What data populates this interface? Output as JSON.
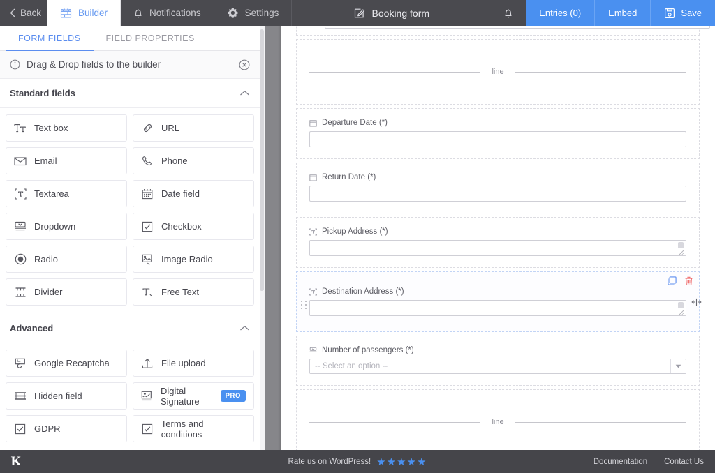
{
  "topbar": {
    "back_label": "Back",
    "tabs": [
      {
        "label": "Builder",
        "icon": "builder-icon",
        "active": true
      },
      {
        "label": "Notifications",
        "icon": "bell-icon",
        "active": false
      },
      {
        "label": "Settings",
        "icon": "gear-icon",
        "active": false
      }
    ],
    "form_title": "Booking form",
    "form_title_icon": "edit-icon",
    "bell_icon": "bell-icon",
    "actions": [
      {
        "label": "Entries (0)",
        "icon": null
      },
      {
        "label": "Embed",
        "icon": null
      },
      {
        "label": "Save",
        "icon": "save-disk-icon"
      }
    ],
    "accent_color": "#4a90f0",
    "bar_color": "#4a4a4f"
  },
  "sidebar": {
    "tabs": [
      {
        "label": "FORM FIELDS",
        "active": true
      },
      {
        "label": "FIELD PROPERTIES",
        "active": false
      }
    ],
    "hint": {
      "text": "Drag & Drop fields to the builder",
      "info_icon": "info-circle-icon",
      "close_icon": "close-circle-icon"
    },
    "sections": [
      {
        "title": "Standard fields",
        "collapse_icon": "chevron-up-icon",
        "fields": [
          {
            "label": "Text box",
            "icon": "text-box-icon"
          },
          {
            "label": "URL",
            "icon": "link-icon"
          },
          {
            "label": "Email",
            "icon": "envelope-icon"
          },
          {
            "label": "Phone",
            "icon": "phone-icon"
          },
          {
            "label": "Textarea",
            "icon": "textarea-icon"
          },
          {
            "label": "Date field",
            "icon": "calendar-icon"
          },
          {
            "label": "Dropdown",
            "icon": "dropdown-icon"
          },
          {
            "label": "Checkbox",
            "icon": "checkbox-icon"
          },
          {
            "label": "Radio",
            "icon": "radio-icon"
          },
          {
            "label": "Image Radio",
            "icon": "image-radio-icon"
          },
          {
            "label": "Divider",
            "icon": "divider-icon"
          },
          {
            "label": "Free Text",
            "icon": "free-text-icon"
          }
        ]
      },
      {
        "title": "Advanced",
        "collapse_icon": "chevron-up-icon",
        "fields": [
          {
            "label": "Google Recaptcha",
            "icon": "recaptcha-icon"
          },
          {
            "label": "File upload",
            "icon": "upload-icon"
          },
          {
            "label": "Hidden field",
            "icon": "hidden-field-icon"
          },
          {
            "label": "Digital Signature",
            "icon": "signature-icon",
            "badge": "PRO"
          },
          {
            "label": "GDPR",
            "icon": "checkbox-icon"
          },
          {
            "label": "Terms and conditions",
            "icon": "checkbox-icon"
          }
        ]
      }
    ]
  },
  "canvas": {
    "fields": [
      {
        "type": "partial-input",
        "label": ""
      },
      {
        "type": "divider",
        "label": "line"
      },
      {
        "type": "text",
        "label": "Departure Date (*)",
        "icon": "calendar-icon"
      },
      {
        "type": "text",
        "label": "Return Date (*)",
        "icon": "calendar-icon"
      },
      {
        "type": "textarea",
        "label": "Pickup Address (*)",
        "icon": "textarea-icon"
      },
      {
        "type": "textarea",
        "label": "Destination Address (*)",
        "icon": "textarea-icon",
        "selected": true,
        "tools": {
          "duplicate_icon": "duplicate-icon",
          "delete_icon": "trash-icon",
          "drag_icon": "drag-handle-icon",
          "resize_icon": "resize-width-icon"
        }
      },
      {
        "type": "select",
        "label": "Number of passengers (*)",
        "icon": "dropdown-icon",
        "placeholder": "-- Select an option --"
      },
      {
        "type": "divider",
        "label": "line"
      }
    ]
  },
  "bottombar": {
    "logo": "K",
    "rate_text": "Rate us on WordPress!",
    "stars": "★★★★★",
    "links": [
      {
        "label": "Documentation"
      },
      {
        "label": "Contact Us"
      }
    ]
  }
}
